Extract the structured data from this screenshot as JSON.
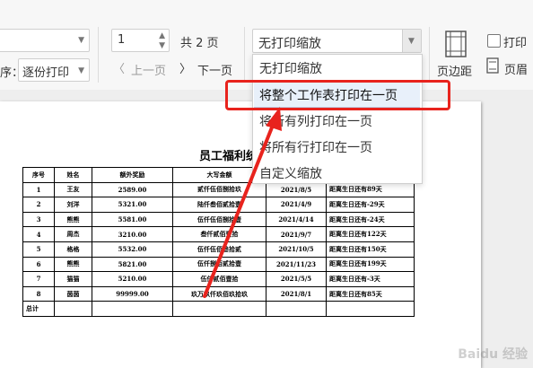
{
  "toolbar": {
    "scale_label": "序：",
    "print_order_value": "逐份打印",
    "copies_value": "1",
    "total_pages_text": "共 2 页",
    "prev_page_label": "上一页",
    "next_page_label": "下一页",
    "zoom_select_value": "无打印缩放",
    "margins_label": "页边距",
    "print_checkbox_label": "打印",
    "header_footer_label": "页眉"
  },
  "dropdown": {
    "items": [
      "无打印缩放",
      "将整个工作表打印在一页",
      "将所有列打印在一页",
      "将所有行打印在一页",
      "自定义缩放"
    ],
    "highlighted_index": 1
  },
  "sheet": {
    "title": "员工福利统",
    "headers": [
      "序号",
      "姓名",
      "额外奖励",
      "大写金额",
      "",
      ""
    ],
    "rows": [
      [
        "1",
        "王友",
        "2589.00",
        "贰仟伍佰捌拾玖",
        "2021/8/5",
        "距离生日还有89天"
      ],
      [
        "2",
        "刘洋",
        "5321.00",
        "陆仟叁佰贰拾壹",
        "2021/4/9",
        "距离生日还有-29天"
      ],
      [
        "3",
        "熊熊",
        "5581.00",
        "伍仟伍佰捌拾壹",
        "2021/4/14",
        "距离生日还有-24天"
      ],
      [
        "4",
        "周杰",
        "3210.00",
        "叁仟贰佰壹拾",
        "2021/9/7",
        "距离生日还有122天"
      ],
      [
        "5",
        "格格",
        "5532.00",
        "伍仟伍佰叁拾贰",
        "2021/10/5",
        "距离生日还有150天"
      ],
      [
        "6",
        "熊熊",
        "5821.00",
        "伍仟捌佰贰拾壹",
        "2021/11/23",
        "距离生日还有199天"
      ],
      [
        "7",
        "猫猫",
        "5210.00",
        "伍仟贰佰壹拾",
        "2021/5/5",
        "距离生日还有-3天"
      ],
      [
        "8",
        "茵茵",
        "99999.00",
        "玖万玖仟玖佰玖拾玖",
        "2021/8/1",
        "距离生日还有85天"
      ]
    ],
    "total_label": "总计"
  },
  "colors": {
    "highlight_box": "#e8231d",
    "arrow": "#e8231d"
  }
}
